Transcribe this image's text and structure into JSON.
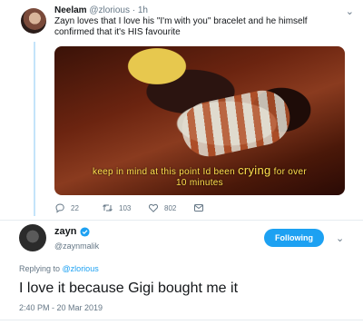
{
  "reply_tweet": {
    "author_name": "Neelam",
    "handle": "@zlorious",
    "separator": "·",
    "time_ago": "1h",
    "text": "Zayn loves that I love his \"I'm with you\" bracelet and he himself confirmed that it's HIS favourite",
    "media": {
      "caption_line1_a": "keep in mind at this point Id been",
      "caption_line1_b": "crying",
      "caption_line1_c": "for over",
      "caption_line2": "10 minutes"
    },
    "actions": {
      "replies": "22",
      "retweets": "103",
      "likes": "802"
    }
  },
  "main_tweet": {
    "author_name": "zayn",
    "verified": true,
    "handle": "@zaynmalik",
    "follow_label": "Following",
    "replying_prefix": "Replying to",
    "replying_handle": "@zlorious",
    "text": "I love it because Gigi bought me it",
    "timestamp": "2:40 PM - 20 Mar 2019"
  },
  "colors": {
    "accent": "#1da1f2",
    "thread_line": "#c4e4fa",
    "caption": "#ffe04d",
    "muted": "#657786"
  },
  "icons": [
    "chevron-down-icon",
    "reply-icon",
    "retweet-icon",
    "like-icon",
    "dm-icon",
    "verified-badge-icon"
  ]
}
